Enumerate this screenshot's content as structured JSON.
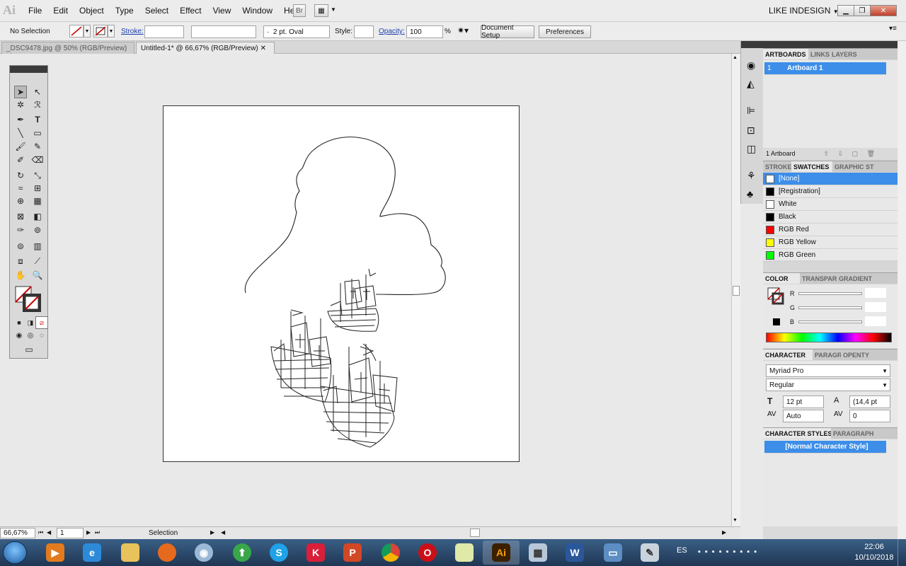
{
  "app": {
    "logo": "Ai",
    "bridge_label": "Br",
    "workspace": "LIKE INDESIGN"
  },
  "menu": [
    "File",
    "Edit",
    "Object",
    "Type",
    "Select",
    "Effect",
    "View",
    "Window",
    "Help"
  ],
  "control": {
    "selection": "No Selection",
    "stroke_label": "Stroke:",
    "brush": "2 pt. Oval",
    "style_label": "Style:",
    "opacity_label": "Opacity:",
    "opacity_value": "100",
    "percent": "%",
    "doc_setup": "Document Setup",
    "preferences": "Preferences"
  },
  "tabs": [
    {
      "label": "_DSC9478.jpg @ 50% (RGB/Preview)",
      "close": "✕"
    },
    {
      "label": "Untitled-1* @ 66,67% (RGB/Preview)",
      "close": "✕"
    }
  ],
  "status": {
    "zoom": "66,67%",
    "page": "1",
    "tool": "Selection"
  },
  "artboards_panel": {
    "tabs": [
      "ARTBOARDS",
      "LINKS",
      "LAYERS"
    ],
    "row_num": "1",
    "row_name": "Artboard 1",
    "footer": "1 Artboard"
  },
  "swatches_panel": {
    "tabs": [
      "STROKE",
      "SWATCHES",
      "GRAPHIC ST"
    ],
    "items": [
      {
        "name": "[None]",
        "color": "none"
      },
      {
        "name": "[Registration]",
        "color": "#000000"
      },
      {
        "name": "White",
        "color": "#ffffff"
      },
      {
        "name": "Black",
        "color": "#000000"
      },
      {
        "name": "RGB Red",
        "color": "#ff0000"
      },
      {
        "name": "RGB Yellow",
        "color": "#ffff00"
      },
      {
        "name": "RGB Green",
        "color": "#00ff00"
      }
    ]
  },
  "color_panel": {
    "tabs": [
      "COLOR",
      "TRANSPAR",
      "GRADIENT"
    ],
    "channels": [
      "R",
      "G",
      "B"
    ]
  },
  "character_panel": {
    "tabs": [
      "CHARACTER",
      "PARAGR",
      "OPENTY"
    ],
    "font": "Myriad Pro",
    "style": "Regular",
    "size": "12 pt",
    "leading": "(14,4 pt",
    "kerning": "Auto",
    "tracking": "0"
  },
  "char_styles_panel": {
    "tabs": [
      "CHARACTER STYLES",
      "PARAGRAPH"
    ],
    "item": "[Normal Character Style]"
  },
  "taskbar": {
    "lang": "ES",
    "time": "22:06",
    "date": "10/10/2018",
    "apps": [
      "start-orb",
      "media-player",
      "internet-explorer",
      "file-explorer",
      "firefox",
      "webcam",
      "android-emulator",
      "skype",
      "kaspersky",
      "powerpoint",
      "chrome",
      "opera",
      "photos",
      "illustrator",
      "calculator",
      "word",
      "photo-gallery",
      "paint"
    ]
  }
}
